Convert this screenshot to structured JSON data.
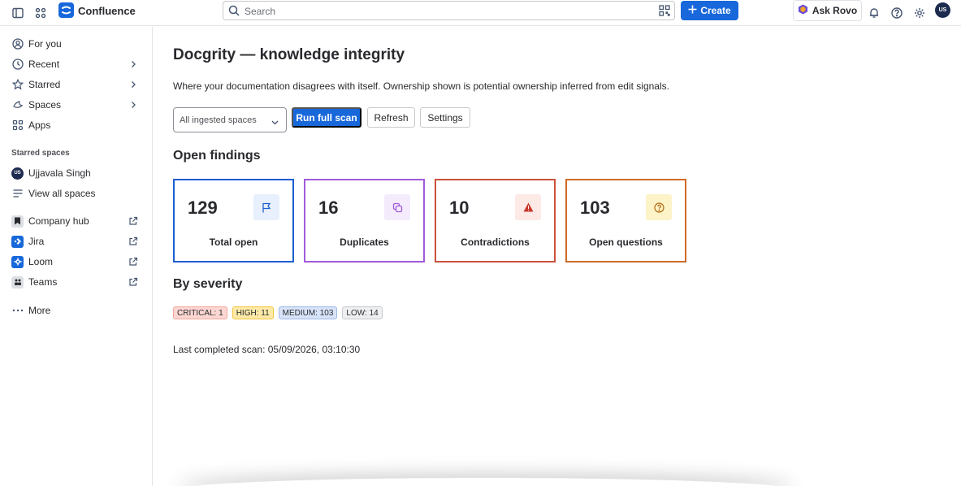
{
  "topbar": {
    "brand": "Confluence",
    "search_placeholder": "Search",
    "create_label": "Create",
    "rovo_label": "Ask Rovo",
    "avatar_initials": "US"
  },
  "sidebar": {
    "items": [
      {
        "label": "For you",
        "icon": "person-icon"
      },
      {
        "label": "Recent",
        "icon": "clock-icon"
      },
      {
        "label": "Starred",
        "icon": "star-icon"
      },
      {
        "label": "Spaces",
        "icon": "spaces-icon"
      },
      {
        "label": "Apps",
        "icon": "apps-icon"
      }
    ],
    "starred_heading": "Starred spaces",
    "starred": [
      {
        "label": "Ujjavala Singh",
        "initials": "US"
      },
      {
        "label": "View all spaces"
      }
    ],
    "apps": [
      {
        "label": "Company hub"
      },
      {
        "label": "Jira"
      },
      {
        "label": "Loom"
      },
      {
        "label": "Teams"
      }
    ],
    "more_label": "More"
  },
  "main": {
    "title": "Docgrity — knowledge integrity",
    "description": "Where your documentation disagrees with itself. Ownership shown is potential ownership inferred from edit signals.",
    "space_select": "All ingested spaces",
    "run_label": "Run full scan",
    "refresh_label": "Refresh",
    "settings_label": "Settings",
    "findings_title": "Open findings",
    "cards": [
      {
        "count": "129",
        "label": "Total open",
        "icon": "flag-icon",
        "color": "#1f5fd1"
      },
      {
        "count": "16",
        "label": "Duplicates",
        "icon": "copy-icon",
        "color": "#a15ad9"
      },
      {
        "count": "10",
        "label": "Contradictions",
        "icon": "warning-icon",
        "color": "#c9513b"
      },
      {
        "count": "103",
        "label": "Open questions",
        "icon": "question-icon",
        "color": "#d06b2a"
      }
    ],
    "severity_title": "By severity",
    "severity": [
      {
        "label": "CRITICAL: 1",
        "bg": "#fcd6d1",
        "border": "#f1a79b"
      },
      {
        "label": "HIGH: 11",
        "bg": "#fdeaa7",
        "border": "#f4c542"
      },
      {
        "label": "MEDIUM: 103",
        "bg": "#d7e3f8",
        "border": "#9fb9e8"
      },
      {
        "label": "LOW: 14",
        "bg": "#eeeff1",
        "border": "#c7c9cd"
      }
    ],
    "last_scan": "Last completed scan: 05/09/2026, 03:10:30"
  }
}
